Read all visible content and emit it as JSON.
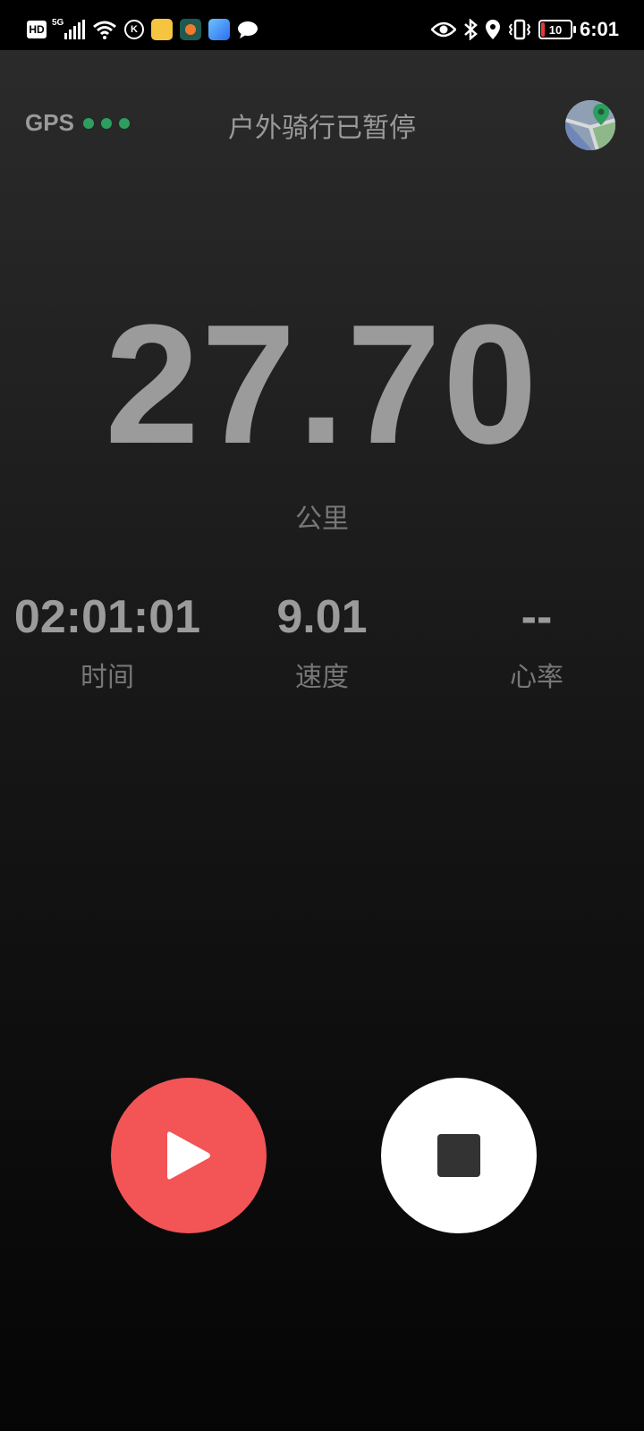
{
  "status_bar": {
    "hd_label": "HD",
    "network_label": "5G",
    "k_label": "K",
    "battery_level": "10",
    "time": "6:01",
    "icons": [
      "hd-icon",
      "signal-icon",
      "wifi-icon",
      "k-icon",
      "app-yellow-icon",
      "app-dark-icon",
      "app-blue-icon",
      "chat-bubble-icon",
      "eye-icon",
      "bluetooth-icon",
      "location-icon",
      "vibrate-icon",
      "battery-icon"
    ]
  },
  "header": {
    "gps_label": "GPS",
    "gps_dot_color": "#2e9e5e",
    "title": "户外骑行已暂停",
    "map_icon": "map-icon"
  },
  "distance": {
    "value": "27.70",
    "unit": "公里"
  },
  "stats": {
    "time": {
      "value": "02:01:01",
      "label": "时间"
    },
    "speed": {
      "value": "9.01",
      "label": "速度"
    },
    "heart_rate": {
      "value": "--",
      "label": "心率"
    }
  },
  "controls": {
    "resume_icon": "play-icon",
    "stop_icon": "stop-icon",
    "resume_color": "#f35456",
    "stop_color": "#ffffff"
  }
}
